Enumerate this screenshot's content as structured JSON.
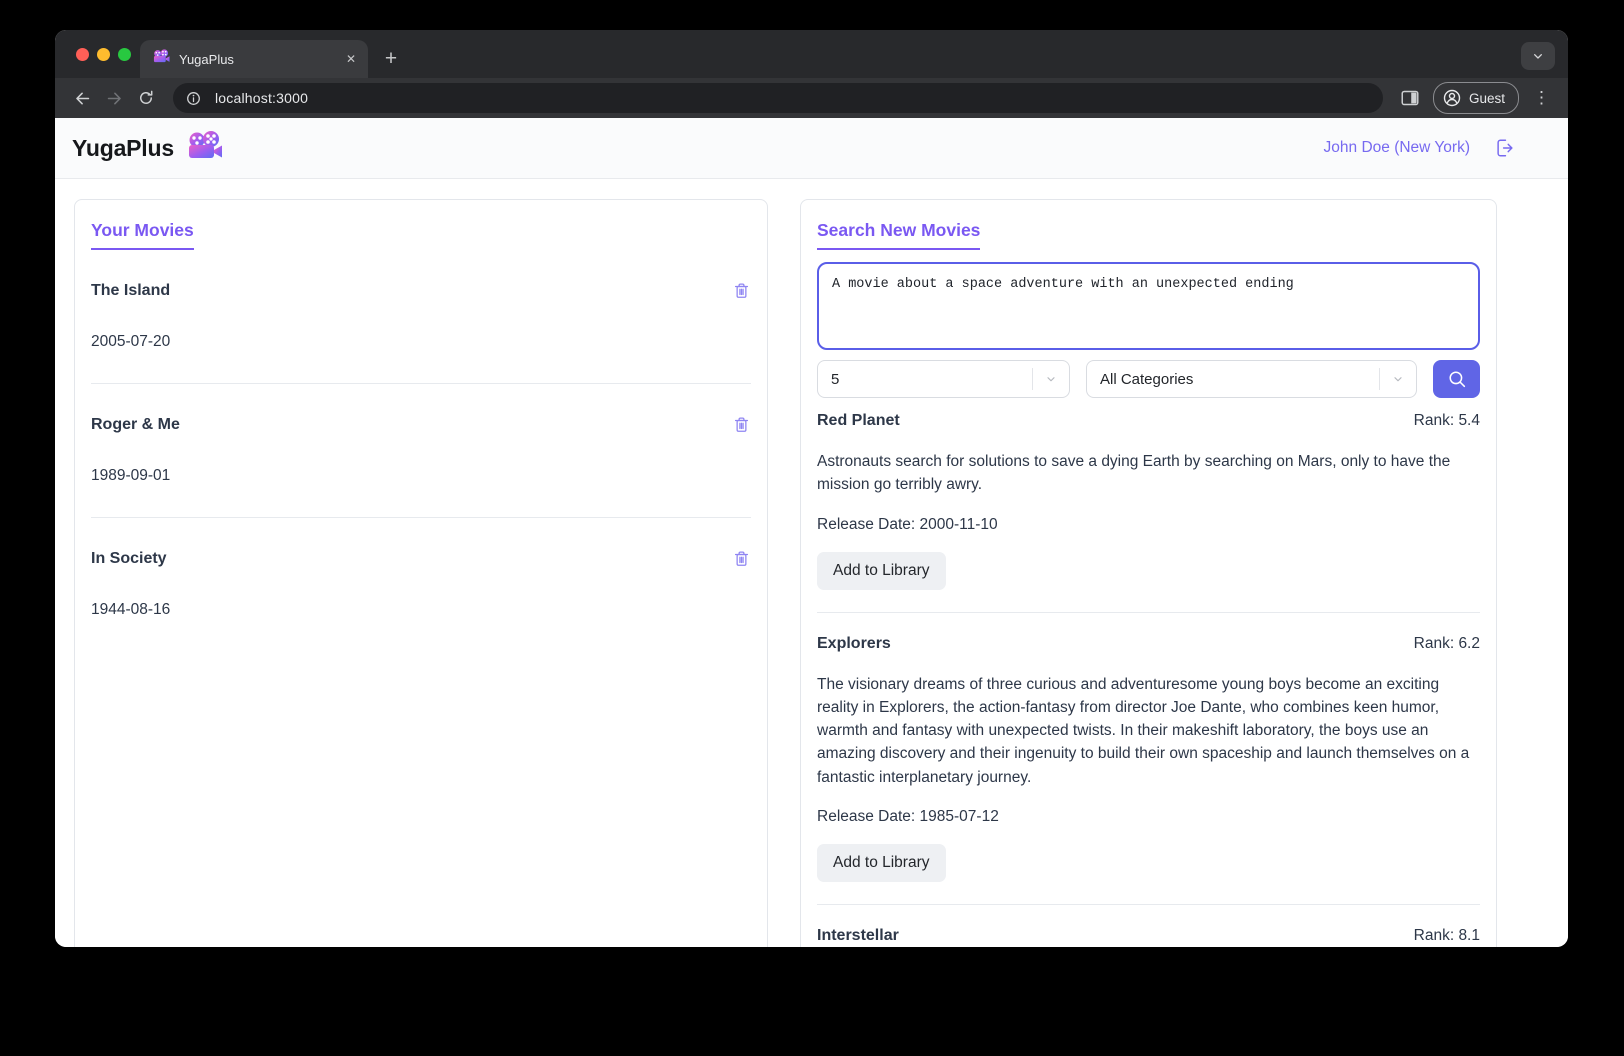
{
  "browser": {
    "tab_title": "YugaPlus",
    "url": "localhost:3000",
    "guest_label": "Guest"
  },
  "header": {
    "app_name": "YugaPlus",
    "user": "John Doe (New York)"
  },
  "library": {
    "title": "Your Movies",
    "movies": [
      {
        "title": "The Island",
        "date": "2005-07-20"
      },
      {
        "title": "Roger & Me",
        "date": "1989-09-01"
      },
      {
        "title": "In Society",
        "date": "1944-08-16"
      }
    ]
  },
  "search": {
    "title": "Search New Movies",
    "query": "A movie about a space adventure with an unexpected ending",
    "limit_value": "5",
    "category_value": "All Categories",
    "add_label": "Add to Library",
    "results": [
      {
        "title": "Red Planet",
        "rank": "Rank: 5.4",
        "description": "Astronauts search for solutions to save a dying Earth by searching on Mars, only to have the mission go terribly awry.",
        "release": "Release Date: 2000-11-10",
        "action": "Add to Library"
      },
      {
        "title": "Explorers",
        "rank": "Rank: 6.2",
        "description": "The visionary dreams of three curious and adventuresome young boys become an exciting reality in Explorers, the action-fantasy from director Joe Dante, who combines keen humor, warmth and fantasy with unexpected twists. In their makeshift laboratory, the boys use an amazing discovery and their ingenuity to build their own spaceship and launch themselves on a fantastic interplanetary journey.",
        "release": "Release Date: 1985-07-12",
        "action": "Add to Library"
      },
      {
        "title": "Interstellar",
        "rank": "Rank: 8.1"
      }
    ]
  },
  "colors": {
    "accent_purple": "#7a58f2",
    "accent_indigo": "#6065e6",
    "link_purple": "#776af0",
    "text_slate": "#2d3748"
  }
}
